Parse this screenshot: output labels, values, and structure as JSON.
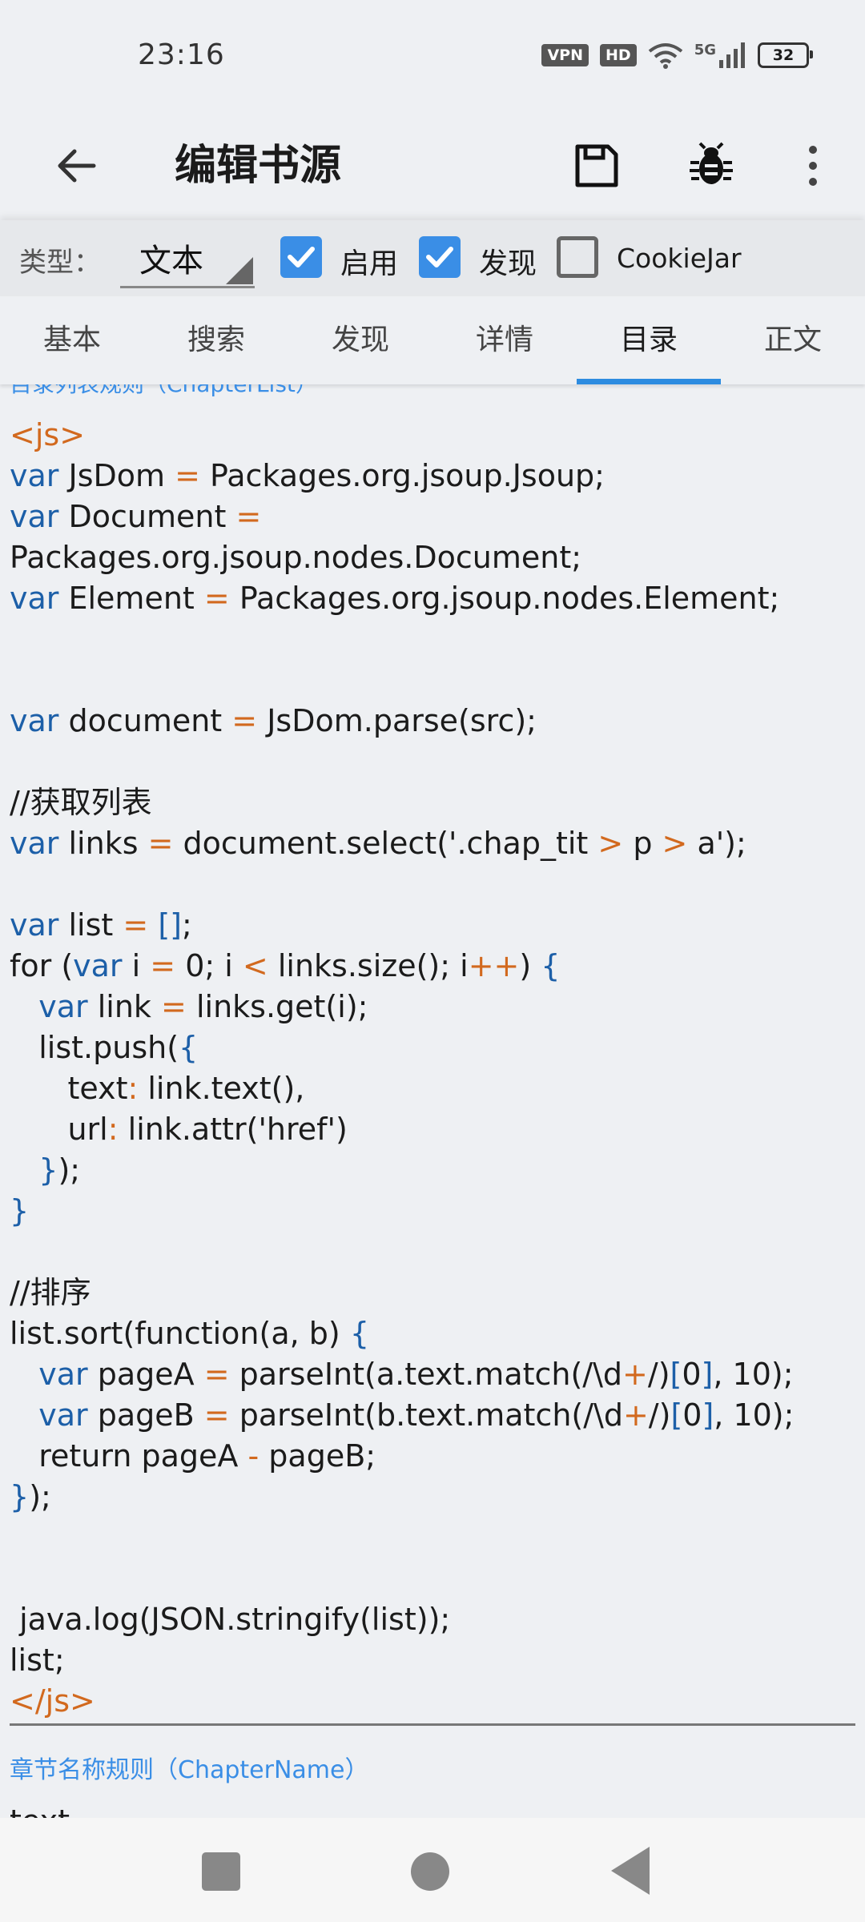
{
  "status_bar": {
    "time": "23:16",
    "badges": [
      "VPN",
      "HD"
    ],
    "network": "5G",
    "battery": "32"
  },
  "app_bar": {
    "title": "编辑书源",
    "icons": [
      "back-arrow-icon",
      "save-icon",
      "bug-icon",
      "more-vert-icon"
    ]
  },
  "options": {
    "type_label": "类型：",
    "type_value": "文本",
    "enabled_label": "启用",
    "enabled_checked": true,
    "discover_label": "发现",
    "discover_checked": true,
    "cookiejar_label": "CookieJar",
    "cookiejar_checked": false
  },
  "tabs": [
    {
      "label": "基本"
    },
    {
      "label": "搜索"
    },
    {
      "label": "发现"
    },
    {
      "label": "详情"
    },
    {
      "label": "目录",
      "active": true
    },
    {
      "label": "正文"
    }
  ],
  "editor": {
    "field_label_partial": "目录列表规则（ChapterList）",
    "code": [
      "<js>",
      "var JsDom = Packages.org.jsoup.Jsoup;",
      "var Document =",
      "Packages.org.jsoup.nodes.Document;",
      "var Element = Packages.org.jsoup.nodes.Element;",
      "",
      "",
      "var document = JsDom.parse(src);",
      "",
      "//获取列表",
      "var links = document.select('.chap_tit > p > a');",
      "",
      "var list = [];",
      "for (var i = 0; i < links.size(); i++) {",
      "   var link = links.get(i);",
      "   list.push({",
      "      text: link.text(),",
      "      url: link.attr('href')",
      "   });",
      "}",
      "",
      "//排序",
      "list.sort(function(a, b) {",
      "   var pageA = parseInt(a.text.match(/\\d+/)[0], 10);",
      "   var pageB = parseInt(b.text.match(/\\d+/)[0], 10);",
      "   return pageA - pageB;",
      "});",
      "",
      "",
      " java.log(JSON.stringify(list));",
      "list;",
      "</js>"
    ],
    "next_field_label": "章节名称规则（ChapterName）",
    "next_field_value_partial": "text"
  },
  "colors": {
    "accent": "#2d8ce0",
    "keyword": "#1c5fa8",
    "operator": "#d2691e",
    "background": "#eef0f3"
  }
}
